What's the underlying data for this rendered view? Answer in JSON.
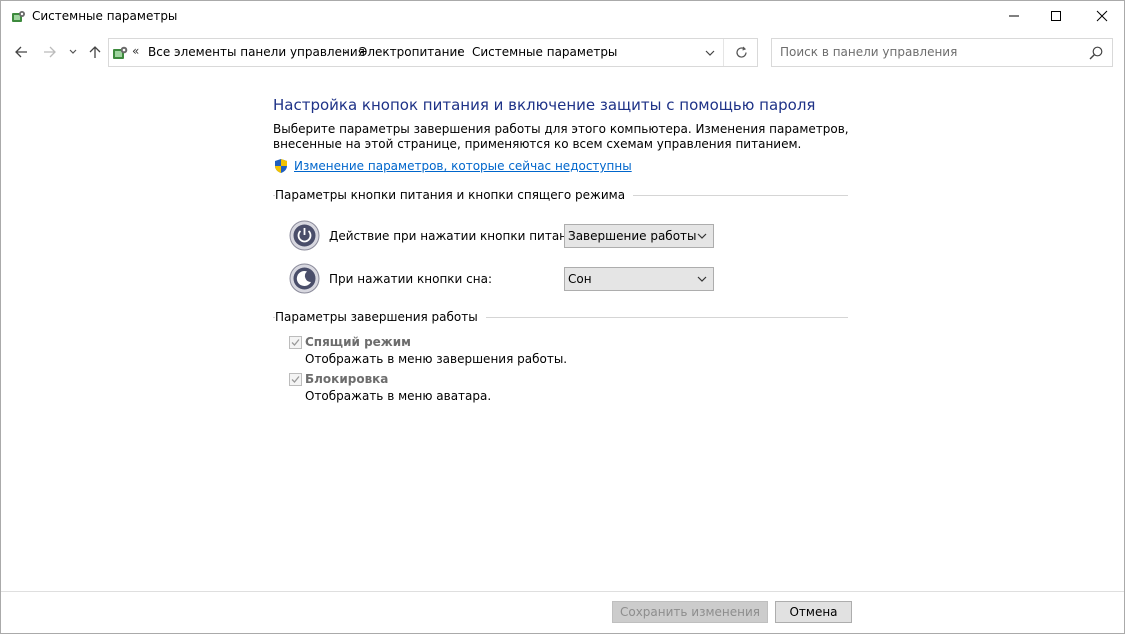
{
  "window": {
    "title": "Системные параметры",
    "icon": "control-panel-icon"
  },
  "navigation": {
    "breadcrumb_overflow": "«",
    "breadcrumbs": [
      "Все элементы панели управления",
      "Электропитание",
      "Системные параметры"
    ],
    "search_placeholder": "Поиск в панели управления"
  },
  "main": {
    "heading": "Настройка кнопок питания и включение защиты с помощью пароля",
    "description": "Выберите параметры завершения работы для этого компьютера. Изменения параметров, внесенные на этой странице, применяются ко всем схемам управления питанием.",
    "admin_link": "Изменение параметров, которые сейчас недоступны",
    "power_section": {
      "title": "Параметры кнопки питания и кнопки спящего режима",
      "rows": [
        {
          "label": "Действие при нажатии кнопки питания:",
          "value": "Завершение работы",
          "icon": "power-button-icon"
        },
        {
          "label": "При нажатии кнопки сна:",
          "value": "Сон",
          "icon": "sleep-button-icon"
        }
      ]
    },
    "shutdown_section": {
      "title": "Параметры завершения работы",
      "options": [
        {
          "label": "Спящий режим",
          "description": "Отображать в меню завершения работы.",
          "checked": true,
          "disabled": true
        },
        {
          "label": "Блокировка",
          "description": "Отображать в меню аватара.",
          "checked": true,
          "disabled": true
        }
      ]
    }
  },
  "footer": {
    "save_label": "Сохранить изменения",
    "cancel_label": "Отмена"
  },
  "colors": {
    "heading": "#1e3287",
    "link": "#0066cc",
    "disabled_text": "#6d6d6d"
  }
}
